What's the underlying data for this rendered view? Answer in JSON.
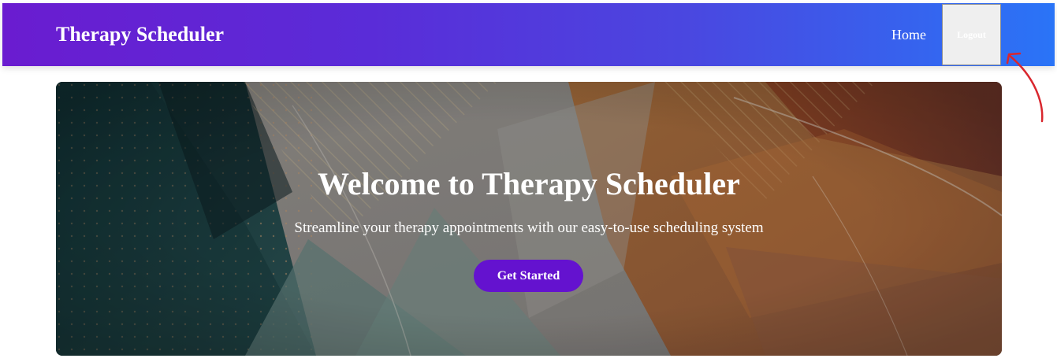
{
  "navbar": {
    "brand": "Therapy Scheduler",
    "home_label": "Home",
    "logout_label": "Logout"
  },
  "hero": {
    "title": "Welcome to Therapy Scheduler",
    "subtitle": "Streamline your therapy appointments with our easy-to-use scheduling system",
    "cta_label": "Get Started"
  },
  "colors": {
    "nav_gradient_start": "#6a1cd0",
    "nav_gradient_end": "#2a74f7",
    "cta_background": "#6412cf",
    "annotation_arrow": "#d9272e"
  }
}
